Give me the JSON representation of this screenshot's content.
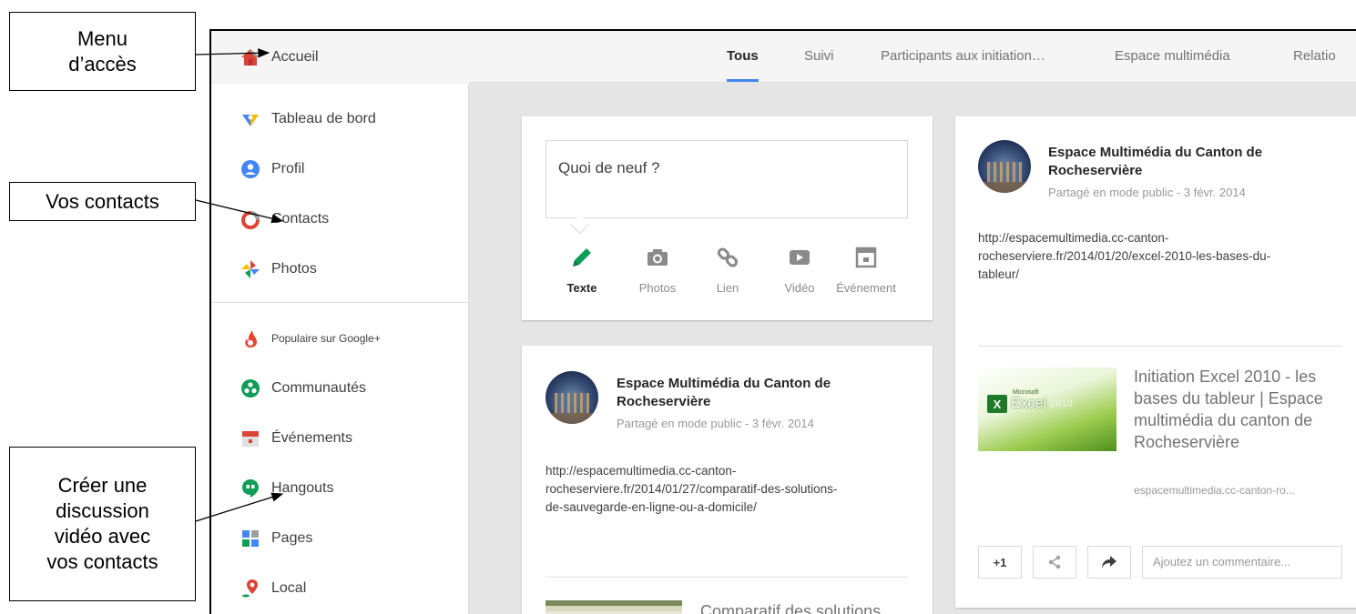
{
  "sidebar": {
    "home": {
      "label": "Accueil",
      "icon": "home-icon"
    },
    "items": [
      {
        "label": "Tableau de bord",
        "icon": "dashboard-icon"
      },
      {
        "label": "Profil",
        "icon": "profile-icon"
      },
      {
        "label": "Contacts",
        "icon": "contacts-icon"
      },
      {
        "label": "Photos",
        "icon": "photos-icon"
      },
      {
        "label": "Populaire sur Google+",
        "icon": "flame-icon"
      },
      {
        "label": "Communautés",
        "icon": "communities-icon"
      },
      {
        "label": "Événements",
        "icon": "calendar-icon"
      },
      {
        "label": "Hangouts",
        "icon": "hangouts-icon"
      },
      {
        "label": "Pages",
        "icon": "pages-icon"
      },
      {
        "label": "Local",
        "icon": "location-pin-icon"
      }
    ]
  },
  "tabs": [
    {
      "label": "Tous",
      "active": true
    },
    {
      "label": "Suivi"
    },
    {
      "label": "Participants aux initiation…"
    },
    {
      "label": "Espace multimédia"
    },
    {
      "label": "Relatio"
    }
  ],
  "share": {
    "placeholder": "Quoi de neuf ?",
    "options": [
      {
        "label": "Texte",
        "icon": "pencil-icon",
        "active": true
      },
      {
        "label": "Photos",
        "icon": "camera-icon"
      },
      {
        "label": "Lien",
        "icon": "link-icon"
      },
      {
        "label": "Vidéo",
        "icon": "video-icon"
      },
      {
        "label": "Événement",
        "icon": "event-icon"
      }
    ]
  },
  "post1": {
    "author_line1": "Espace Multimédia du Canton de",
    "author_line2": "Rocheservière",
    "meta": "Partagé en mode public  -  3 févr. 2014",
    "link_line1": "http://espacemultimedia.cc-canton-",
    "link_line2": "rocheserviere.fr/2014/01/27/comparatif-des-solutions-",
    "link_line3": "de-sauvegarde-en-ligne-ou-a-domicile/",
    "preview_title": "Comparatif des solutions"
  },
  "post2": {
    "author_line1": "Espace Multimédia du Canton de",
    "author_line2": "Rocheservière",
    "meta": "Partagé en mode public  -  3 févr. 2014",
    "link_line1": "http://espacemultimedia.cc-canton-",
    "link_line2": "rocheserviere.fr/2014/01/20/excel-2010-les-bases-du-",
    "link_line3": "tableur/",
    "preview": {
      "title_line1": "Initiation Excel 2010 - les",
      "title_line2": "bases du tableur | Espace",
      "title_line3": "multimédia du canton de",
      "title_line4": "Rocheservière",
      "domain": "espacemultimedia.cc-canton-ro...",
      "thumb_microsoft": "Microsoft",
      "thumb_product": "Excel",
      "thumb_year": "2010"
    },
    "plus_one": "+1",
    "comment_placeholder": "Ajoutez un commentaire..."
  },
  "callouts": {
    "menu": [
      "Menu",
      "d’accès"
    ],
    "contacts": [
      "Vos contacts"
    ],
    "hangouts": [
      "Créer une",
      "discussion",
      "vidéo avec",
      "vos contacts"
    ]
  },
  "colors": {
    "accent": "#4285f4",
    "home": "#db4437",
    "background": "#e5e5e5"
  }
}
